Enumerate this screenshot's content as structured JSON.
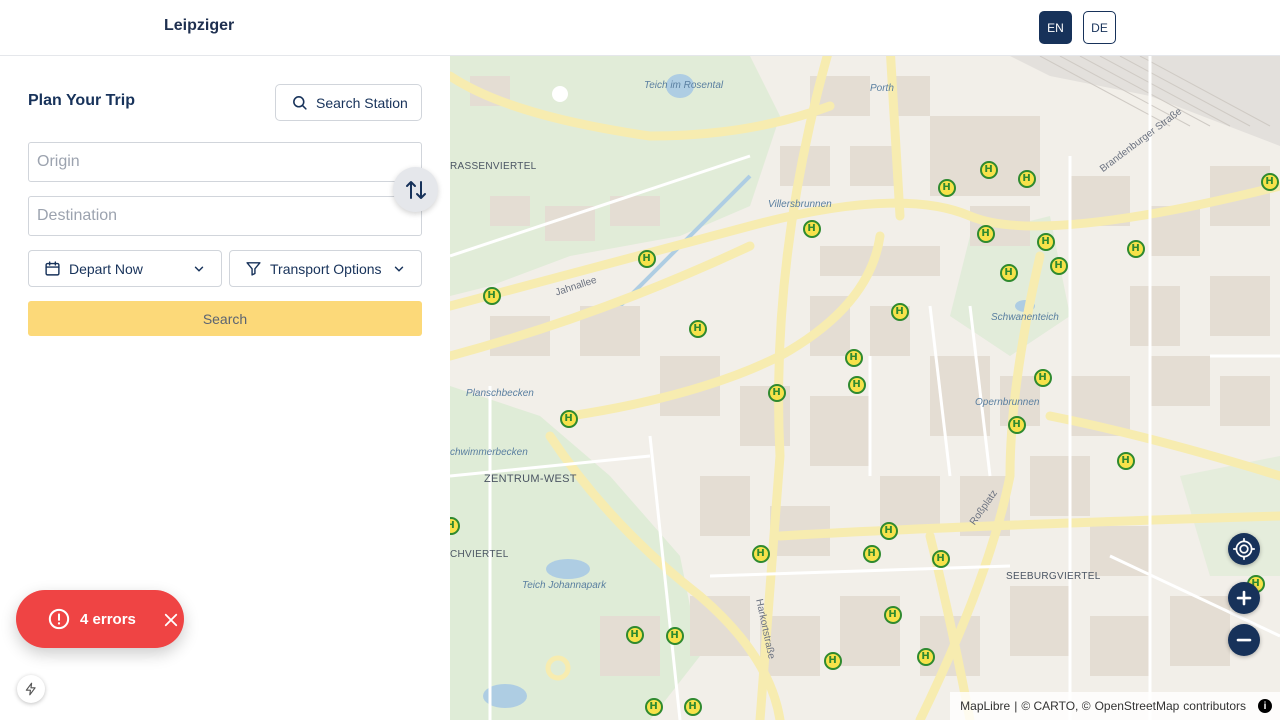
{
  "header": {
    "brand": "Leipziger",
    "lang_en": "EN",
    "lang_de": "DE"
  },
  "planner": {
    "title": "Plan Your Trip",
    "search_station_label": "Search Station",
    "origin_placeholder": "Origin",
    "destination_placeholder": "Destination",
    "depart_label": "Depart Now",
    "transport_label": "Transport Options",
    "search_label": "Search"
  },
  "errors": {
    "label": "4 errors"
  },
  "map": {
    "labels": {
      "teich_rosental": "Teich im Rosental",
      "porth": "Porth",
      "brandenburger": "Brandenburger Straße",
      "strassenviertel": "RASSENVIERTEL",
      "villersbrunnen": "Villersbrunnen",
      "jahnallee": "Jahnallee",
      "schwanenteich": "Schwanenteich",
      "planschbecken": "Planschbecken",
      "opernbrunnen": "Opernbrunnen",
      "schwimmerbecken": "chwimmerbecken",
      "zentrum_west": "ZENTRUM-WEST",
      "rossplatz": "Roßplatz",
      "hviertel": "CHVIERTEL",
      "seeburgviertel": "SEEBURGVIERTEL",
      "teich_johannapark": "Teich Johannapark",
      "harkortstrasse": "Harkortstraße"
    },
    "attribution": {
      "maplibre": "MapLibre",
      "carto": "© CARTO, ©",
      "osm": "OpenStreetMap",
      "contrib": "contributors",
      "sep": "|"
    }
  }
}
